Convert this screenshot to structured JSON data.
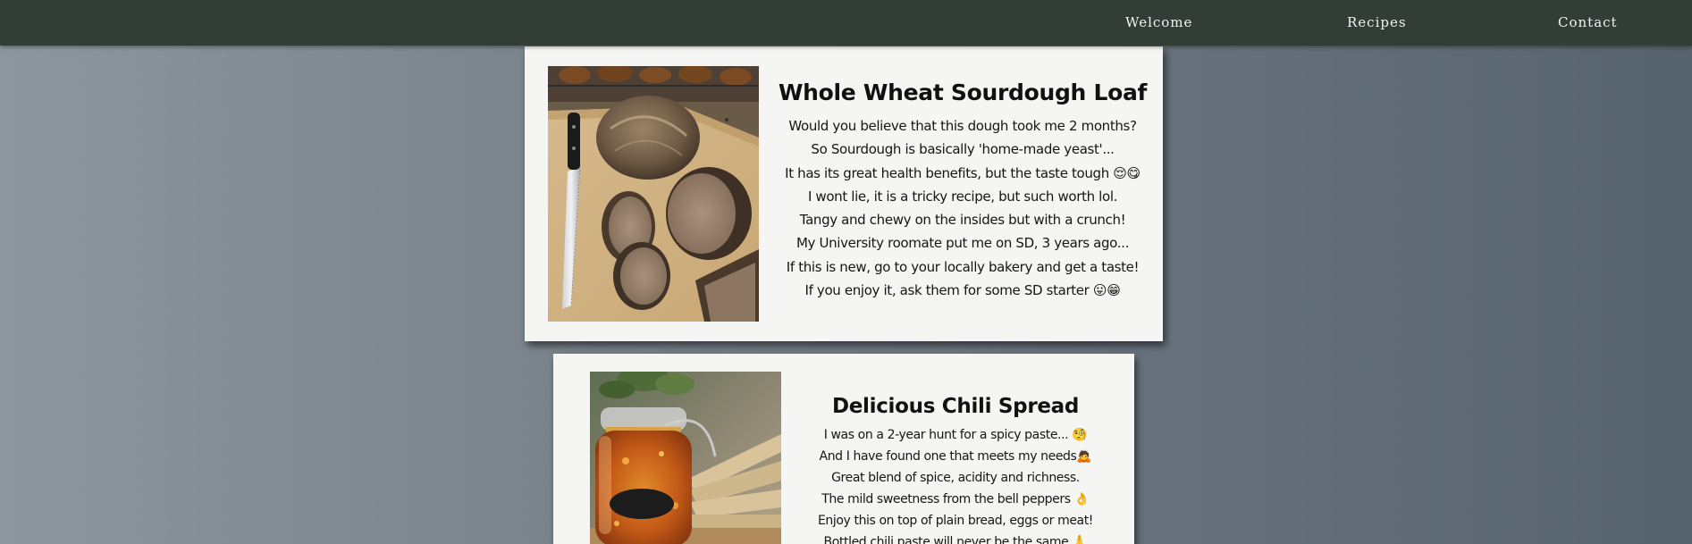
{
  "nav": {
    "welcome": "Welcome",
    "recipes": "Recipes",
    "contact": "Contact"
  },
  "recipes": [
    {
      "title": "Whole Wheat Sourdough Loaf",
      "image": "sourdough-bread-photo",
      "lines": [
        "Would you believe that this dough took me 2 months?",
        "So Sourdough is basically 'home-made yeast'...",
        "It has its great health benefits, but the taste tough 😌😋",
        "I wont lie, it is a tricky recipe, but such worth lol.",
        "Tangy and chewy on the insides but with a crunch!",
        "My University roomate put me on SD, 3 years ago...",
        "If this is new, go to your locally bakery and get a taste!",
        "If you enjoy it, ask them for some SD starter 😛😁"
      ]
    },
    {
      "title": "Delicious Chili Spread",
      "image": "chili-spread-jar-photo",
      "lines": [
        "I was on a 2-year hunt for a spicy paste... 🧐",
        "And I have found one that meets my needs🙇",
        "Great blend of spice, acidity and richness.",
        "The mild sweetness from the bell peppers 👌",
        "Enjoy this on top of plain bread, eggs or meat!",
        "Bottled chili paste will never be the same 🙏"
      ]
    }
  ],
  "colors": {
    "navbar": "#333d38",
    "card": "#f5f5f4",
    "nav_text": "#f2f2f2"
  }
}
